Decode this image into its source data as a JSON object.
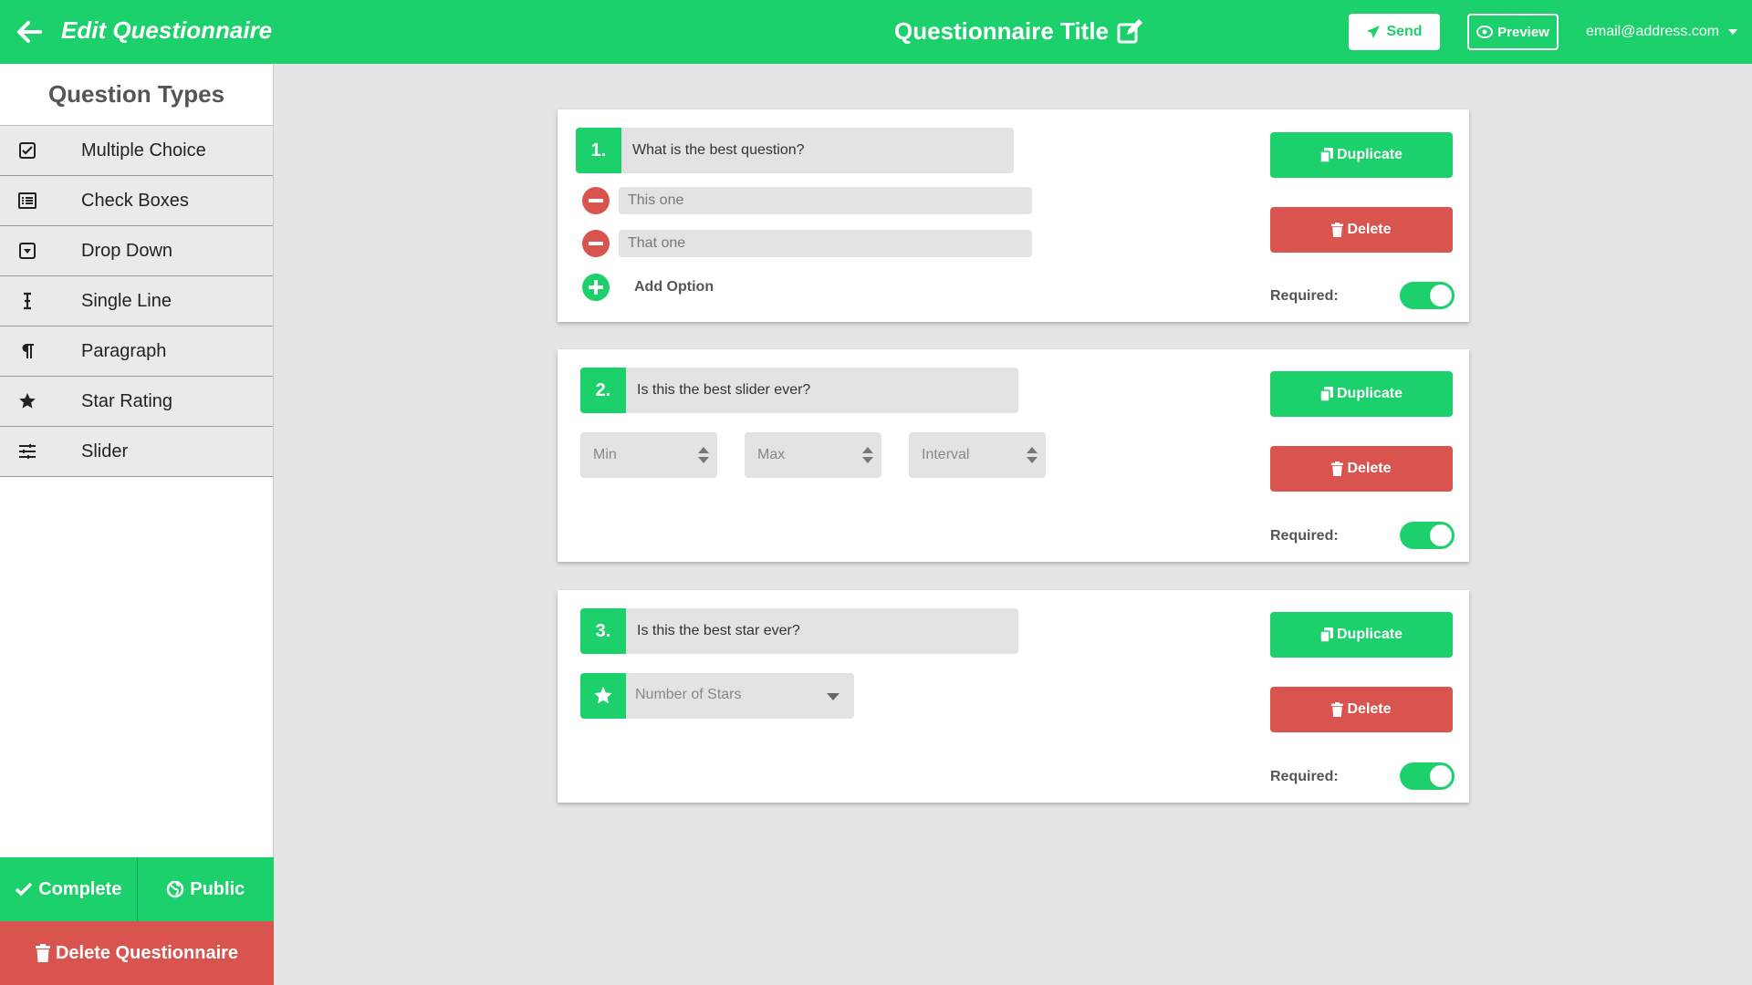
{
  "header": {
    "app_title": "Edit Questionnaire",
    "questionnaire_title": "Questionnaire Title",
    "send_label": "Send",
    "preview_label": "Preview",
    "user_email": "email@address.com"
  },
  "sidebar": {
    "title": "Question Types",
    "items": [
      {
        "label": "Multiple Choice",
        "icon": "checkbox-icon"
      },
      {
        "label": "Check Boxes",
        "icon": "list-icon"
      },
      {
        "label": "Drop Down",
        "icon": "dropdown-icon"
      },
      {
        "label": "Single Line",
        "icon": "text-cursor-icon"
      },
      {
        "label": "Paragraph",
        "icon": "paragraph-icon"
      },
      {
        "label": "Star Rating",
        "icon": "star-icon"
      },
      {
        "label": "Slider",
        "icon": "sliders-icon"
      }
    ],
    "complete_label": "Complete",
    "public_label": "Public",
    "delete_label": "Delete Questionnaire"
  },
  "questions": [
    {
      "number": "1.",
      "text": "What is the best question?",
      "options": [
        "This one",
        "That one"
      ],
      "add_option_label": "Add Option"
    },
    {
      "number": "2.",
      "text": "Is this the best slider ever?",
      "min_placeholder": "Min",
      "max_placeholder": "Max",
      "interval_placeholder": "Interval"
    },
    {
      "number": "3.",
      "text": "Is this the best star ever?",
      "stars_placeholder": "Number of Stars"
    }
  ],
  "card_actions": {
    "duplicate_label": "Duplicate",
    "delete_label": "Delete",
    "required_label": "Required:"
  },
  "colors": {
    "accent": "#1cd06b",
    "danger": "#d9534f",
    "field": "#e3e3e3"
  }
}
